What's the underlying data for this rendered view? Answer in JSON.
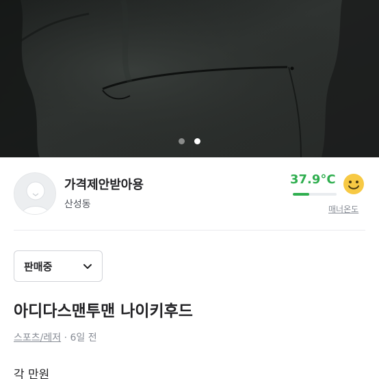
{
  "carousel": {
    "total": 2,
    "active_index": 1
  },
  "seller": {
    "nickname": "가격제안받아용",
    "location": "산성동",
    "manner_temperature": "37.9°C",
    "manner_label": "매너온도",
    "temperature_level": 0.38,
    "temperature_color": "#2fae4f"
  },
  "product": {
    "status": "판매중",
    "title": "아디다스맨투맨 나이키후드",
    "category": "스포츠/레저",
    "separator": "·",
    "time_ago": "6일 전",
    "description": "각 만원"
  }
}
